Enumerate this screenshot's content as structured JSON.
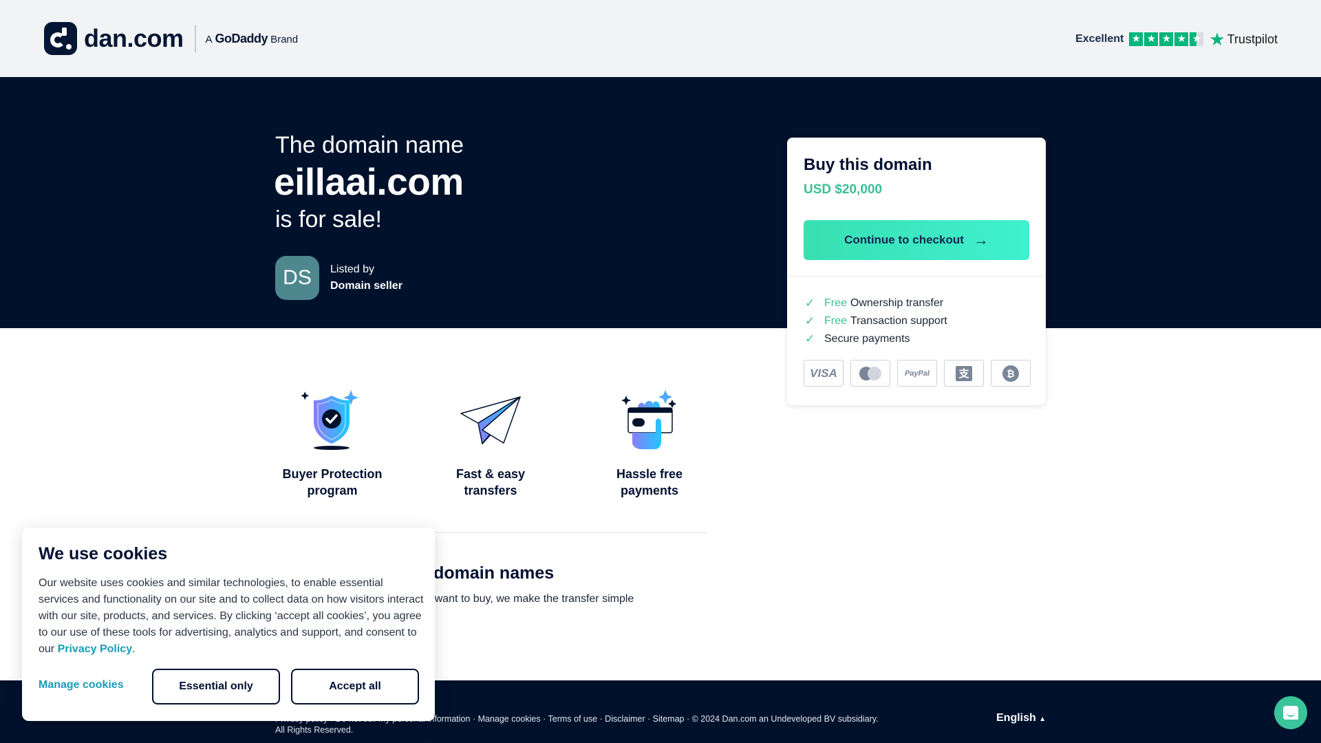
{
  "header": {
    "logo_text": "dan.com",
    "brand_prefix": "A",
    "brand_name": "GoDaddy",
    "brand_suffix": "Brand",
    "trustpilot": {
      "rating_label": "Excellent",
      "stars": 4.5,
      "logo_text": "Trustpilot"
    }
  },
  "hero": {
    "line1": "The domain name",
    "domain": "eillaai.com",
    "line3": "is for sale!",
    "seller": {
      "avatar_initials": "DS",
      "listed_by_label": "Listed by",
      "name": "Domain seller"
    }
  },
  "buy_card": {
    "title": "Buy this domain",
    "price": "USD $20,000",
    "checkout_label": "Continue to checkout",
    "features": [
      {
        "prefix": "Free",
        "text": "Ownership transfer"
      },
      {
        "prefix": "Free",
        "text": "Transaction support"
      },
      {
        "prefix": "",
        "text": "Secure payments"
      }
    ],
    "payment_methods": [
      {
        "name": "visa",
        "label": "VISA"
      },
      {
        "name": "mastercard",
        "label": ""
      },
      {
        "name": "paypal",
        "label": "PayPal"
      },
      {
        "name": "alipay",
        "label": "支"
      },
      {
        "name": "bitcoin",
        "label": "₿"
      }
    ]
  },
  "benefits": [
    {
      "icon": "shield-check-icon",
      "line1": "Buyer Protection",
      "line2": "program"
    },
    {
      "icon": "paper-plane-icon",
      "line1": "Fast & easy",
      "line2": "transfers"
    },
    {
      "icon": "hand-card-icon",
      "line1": "Hassle free",
      "line2": "payments"
    }
  ],
  "info_section": {
    "heading": "The easy way to buy domain names",
    "subtext": "When you find a domain name you want to buy, we make the transfer simple"
  },
  "footer": {
    "links": [
      "Privacy policy",
      "Do not sell my personal information",
      "Manage cookies",
      "Terms of use",
      "Disclaimer",
      "Sitemap"
    ],
    "copyright": "© 2024 Dan.com an Undeveloped BV subsidiary. All Rights Reserved.",
    "language": "English"
  },
  "cookie_banner": {
    "title": "We use cookies",
    "text": "Our website uses cookies and similar technologies, to enable essential services and functionality on our site and to collect data on how visitors interact with our site, products, and services. By clicking ‘accept all cookies’, you agree to our use of these tools for advertising, analytics and support, and consent to our ",
    "privacy_link": "Privacy Policy",
    "text_end": ".",
    "manage_label": "Manage cookies",
    "essential_label": "Essential only",
    "accept_label": "Accept all"
  },
  "colors": {
    "hero_bg": "#00112c",
    "accent_green": "#3bbf95",
    "checkout_btn": "#38e0b2",
    "link_blue": "#1a9bb8",
    "trustpilot_green": "#00b67a"
  }
}
